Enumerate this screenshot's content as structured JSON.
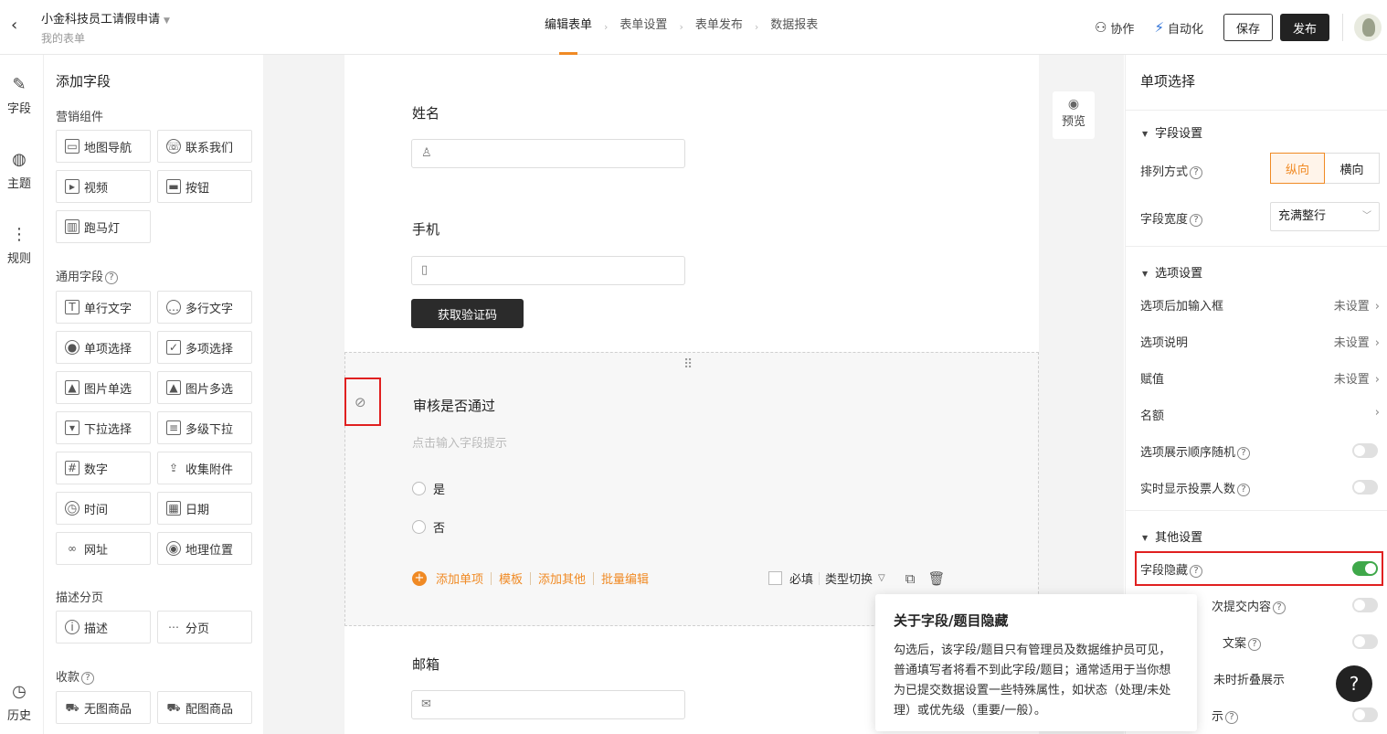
{
  "header": {
    "form_title": "小金科技员工请假申请",
    "form_sub": "我的表单",
    "steps": [
      "编辑表单",
      "表单设置",
      "表单发布",
      "数据报表"
    ],
    "collab": "协作",
    "automate": "自动化",
    "save": "保存",
    "publish": "发布"
  },
  "rail": [
    {
      "label": "字段",
      "icon": "edit-icon"
    },
    {
      "label": "主题",
      "icon": "palette-icon"
    },
    {
      "label": "规则",
      "icon": "rules-icon"
    },
    {
      "label": "历史",
      "icon": "history-icon"
    }
  ],
  "left": {
    "title": "添加字段",
    "sections": {
      "marketing": "营销组件",
      "common": "通用字段",
      "desc": "描述分页",
      "pay": "收款"
    },
    "marketing": [
      "地图导航",
      "联系我们",
      "视频",
      "按钮",
      "跑马灯"
    ],
    "common": [
      "单行文字",
      "多行文字",
      "单项选择",
      "多项选择",
      "图片单选",
      "图片多选",
      "下拉选择",
      "多级下拉",
      "数字",
      "收集附件",
      "时间",
      "日期",
      "网址",
      "地理位置"
    ],
    "desc": [
      "描述",
      "分页"
    ],
    "pay": [
      "无图商品",
      "配图商品"
    ]
  },
  "form": {
    "name_label": "姓名",
    "phone_label": "手机",
    "get_code": "获取验证码",
    "field_title": "审核是否通过",
    "field_hint": "点击输入字段提示",
    "options": [
      "是",
      "否"
    ],
    "actions": [
      "添加单项",
      "模板",
      "添加其他",
      "批量编辑"
    ],
    "required": "必填",
    "type_switch": "类型切换",
    "email_label": "邮箱",
    "preview": "预览"
  },
  "right": {
    "title": "单项选择",
    "field_settings": "字段设置",
    "arrange_label": "排列方式",
    "arrange_options": [
      "纵向",
      "横向"
    ],
    "width_label": "字段宽度",
    "width_value": "充满整行",
    "option_settings": "选项设置",
    "rows": [
      {
        "label": "选项后加输入框",
        "value": "未设置"
      },
      {
        "label": "选项说明",
        "value": "未设置"
      },
      {
        "label": "赋值",
        "value": "未设置"
      },
      {
        "label": "名额",
        "value": ""
      }
    ],
    "random_label": "选项展示顺序随机",
    "votes_label": "实时显示投票人数",
    "other_settings": "其他设置",
    "hide_label": "字段隐藏",
    "partial": [
      "次提交内容",
      "文案",
      "未时折叠展示",
      "示"
    ]
  },
  "tooltip": {
    "title": "关于字段/题目隐藏",
    "body": "勾选后，该字段/题目只有管理员及数据维护员可见，普通填写者将看不到此字段/题目；通常适用于当你想为已提交数据设置一些特殊属性，如状态（处理/未处理）或优先级（重要/一般）。"
  },
  "help": "?"
}
